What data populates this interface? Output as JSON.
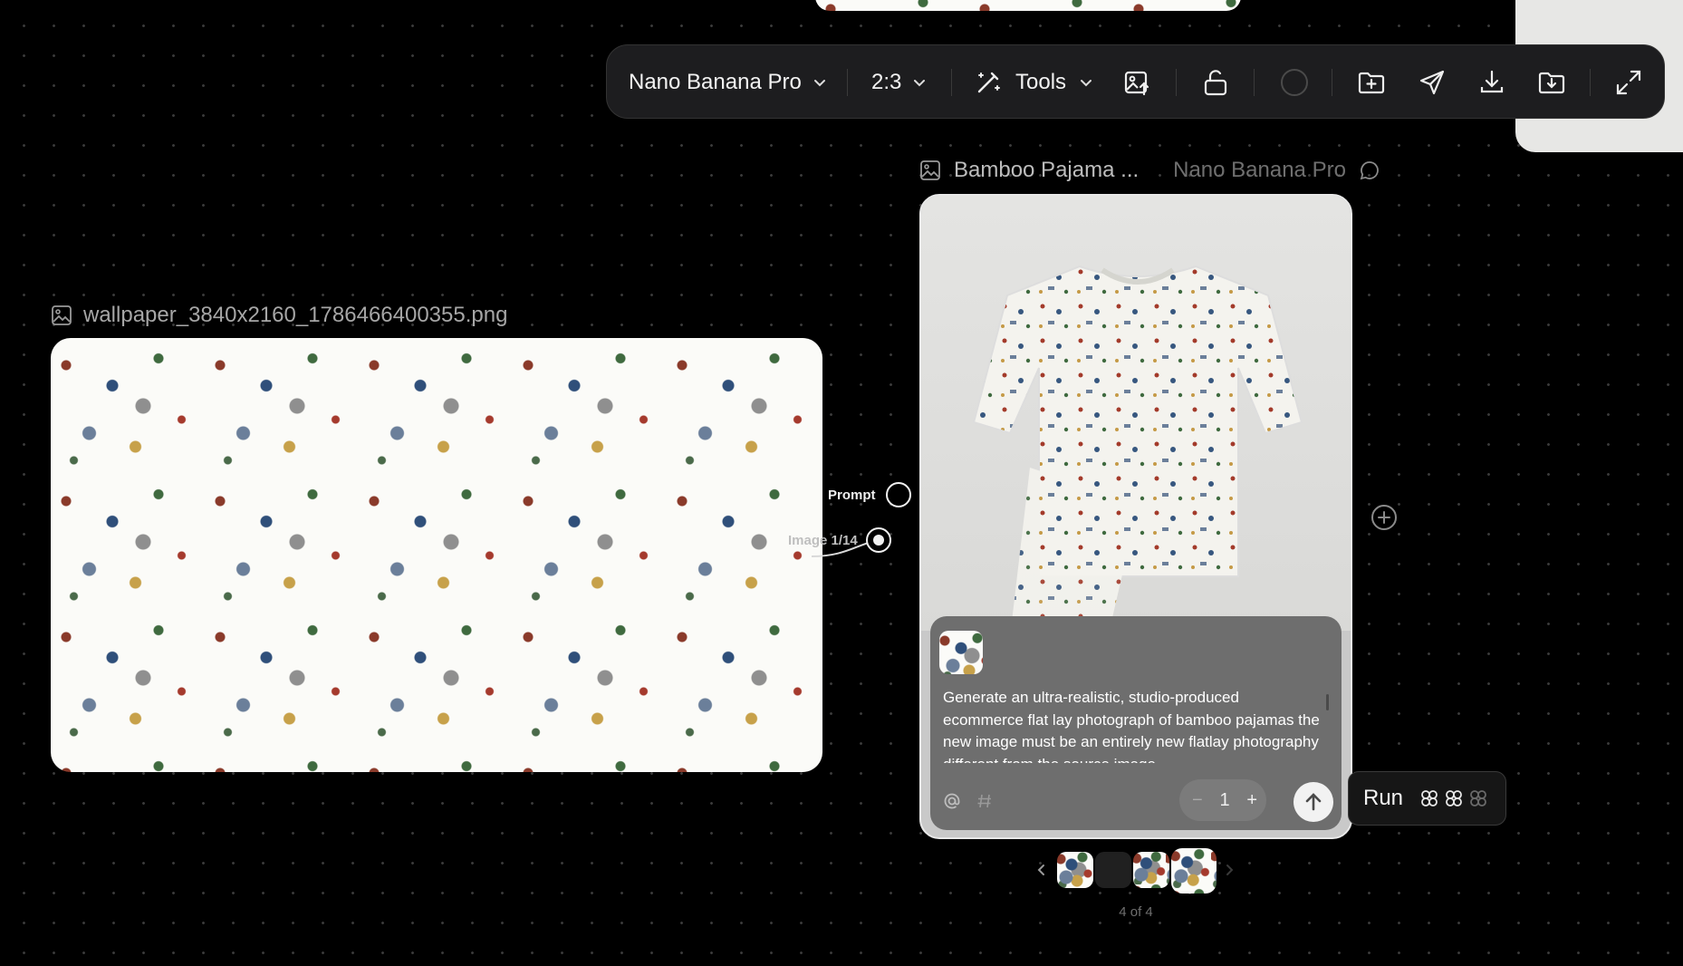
{
  "toolbar": {
    "model_label": "Nano Banana Pro",
    "ratio_label": "2:3",
    "tools_label": "Tools"
  },
  "left_node": {
    "filename": "wallpaper_3840x2160_1786466400355.png"
  },
  "ports": {
    "prompt_label": "Prompt",
    "image_label": "Image 1/14"
  },
  "right_node": {
    "title": "Bamboo Pajama ...",
    "model": "Nano Banana Pro",
    "prompt_text": "Generate an ultra-realistic, studio-produced ecommerce flat lay photograph of bamboo pajamas the new image must be an entirely new flatlay photography different from the source image.",
    "count": "1"
  },
  "run": {
    "label": "Run"
  },
  "carousel": {
    "counter": "4 of 4"
  },
  "icons": [
    "chevron-down-icon",
    "magic-wand-icon",
    "image-upload-icon",
    "unlock-icon",
    "circle-icon",
    "add-folder-icon",
    "send-icon",
    "download-icon",
    "save-folder-icon",
    "expand-icon",
    "image-icon",
    "chat-bubble-icon",
    "plus-circle-icon",
    "at-icon",
    "hash-icon",
    "settings-sliders-icon",
    "arrow-up-icon",
    "chevron-left-icon",
    "chevron-right-icon",
    "credits-icon"
  ]
}
